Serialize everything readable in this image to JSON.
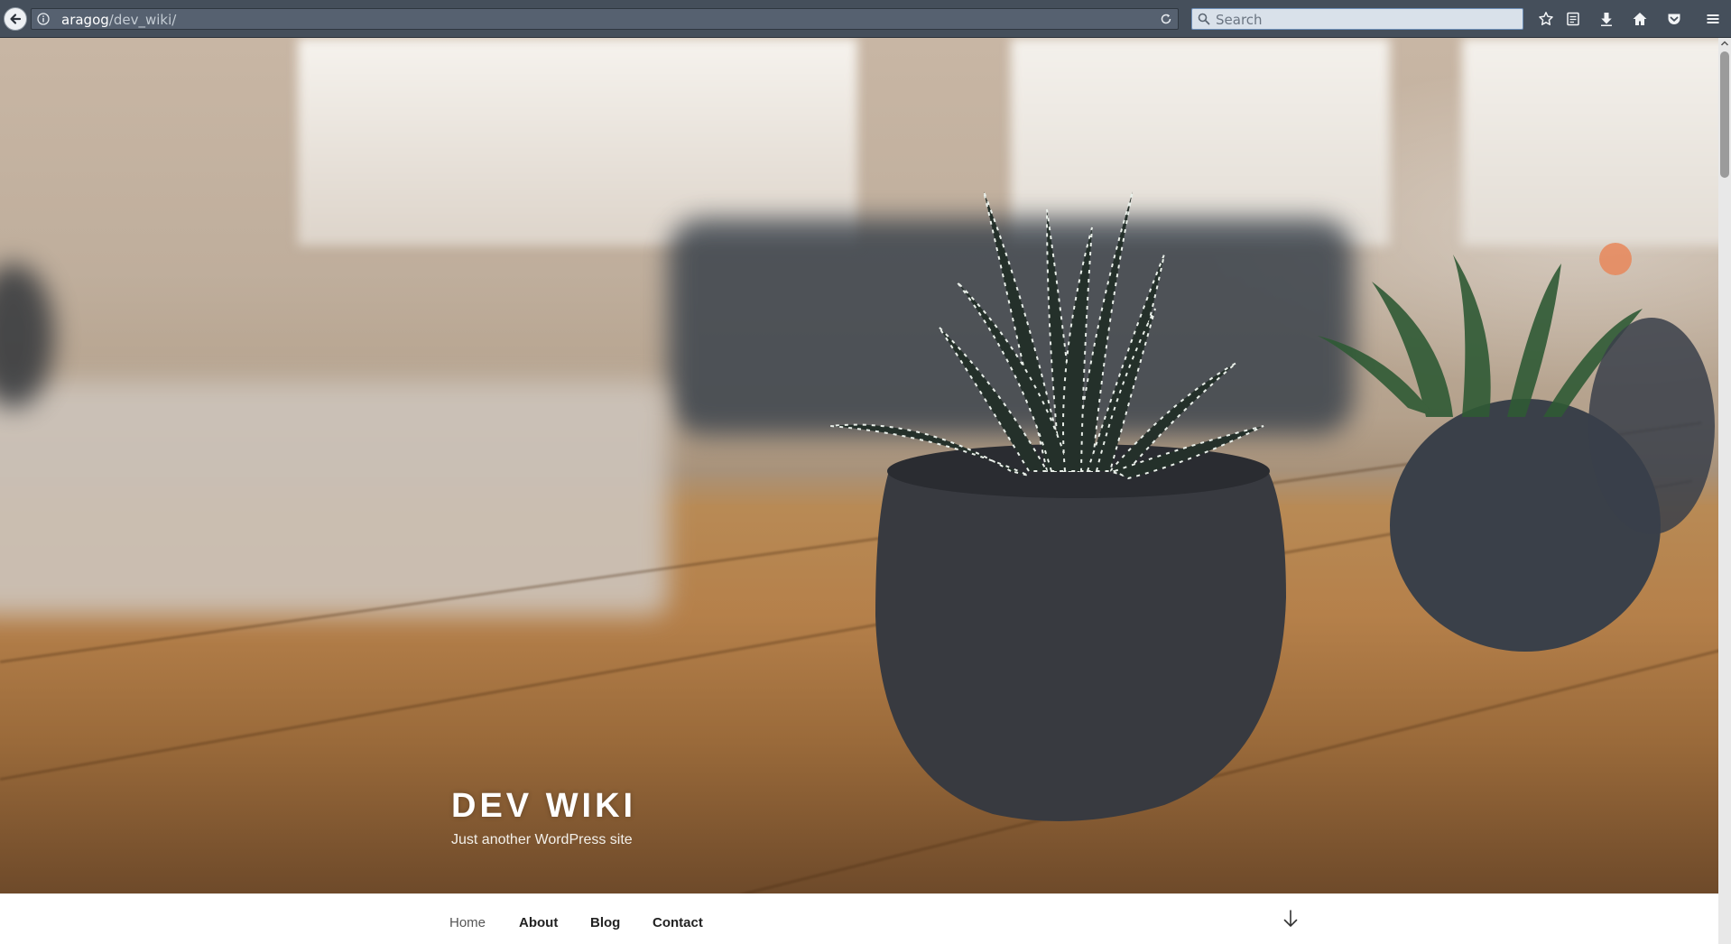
{
  "browser": {
    "url_host": "aragog",
    "url_path": "/dev_wiki/",
    "search_placeholder": "Search",
    "icons": [
      "back-arrow-icon",
      "info-icon",
      "reload-icon",
      "search-icon",
      "star-icon",
      "reading-list-icon",
      "download-icon",
      "home-icon",
      "pocket-icon",
      "menu-icon"
    ]
  },
  "site": {
    "title": "DEV WIKI",
    "description": "Just another WordPress site"
  },
  "nav": {
    "items": [
      {
        "label": "Home",
        "current": true
      },
      {
        "label": "About",
        "current": false
      },
      {
        "label": "Blog",
        "current": false
      },
      {
        "label": "Contact",
        "current": false
      }
    ]
  },
  "colors": {
    "toolbar": "#454f5b",
    "urlbar": "#566170",
    "searchbar": "#d9e1ea",
    "title": "#ffffff"
  }
}
